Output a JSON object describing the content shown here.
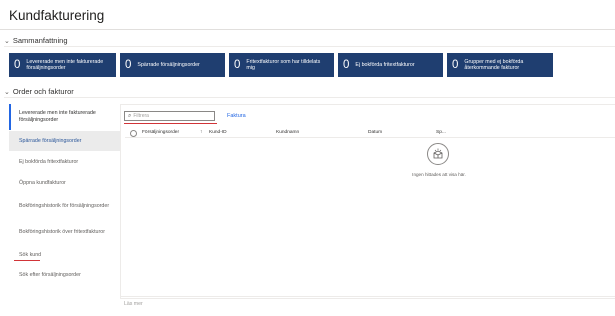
{
  "page": {
    "title": "Kundfakturering"
  },
  "summary": {
    "heading": "Sammanfattning",
    "tiles": [
      {
        "count": "0",
        "label": "Levererade men inte fakturerade försäljningsorder"
      },
      {
        "count": "0",
        "label": "Spärrade försäljningsorder"
      },
      {
        "count": "0",
        "label": "Fritextfakturor som har tilldelats mig"
      },
      {
        "count": "0",
        "label": "Ej bokförda fritextfakturor"
      },
      {
        "count": "0",
        "label": "Grupper med ej bokförda återkommande fakturor"
      }
    ]
  },
  "orders": {
    "heading": "Order och fakturor",
    "nav": [
      "Levererade men inte fakturerade försäljningsorder",
      "Spärrade försäljningsorder",
      "Ej bokförda fritextfakturor",
      "Öppna kundfakturor",
      "Bokföringshistorik för försäljningsorder",
      "Bokföringshistorik över fritextfakturor",
      "Sök kund",
      "Sök efter försäljningsorder"
    ],
    "filter_placeholder": "Filtrera",
    "faktura_tab": "Faktura",
    "columns": [
      "Försäljningsorder",
      "Kund-ID",
      "Kundnamn",
      "Datum",
      "Sp..."
    ],
    "sort_indicator": "↑",
    "empty_message": "Ingen hittades att visa här.",
    "read_more": "Läs mer"
  },
  "colors": {
    "tile_bg": "#1f3e70",
    "accent": "#2266e3",
    "underline": "#d13438"
  },
  "icons": {
    "section_toggle": "chevron-down-icon",
    "filter": "search-icon",
    "empty": "empty-box-icon"
  }
}
